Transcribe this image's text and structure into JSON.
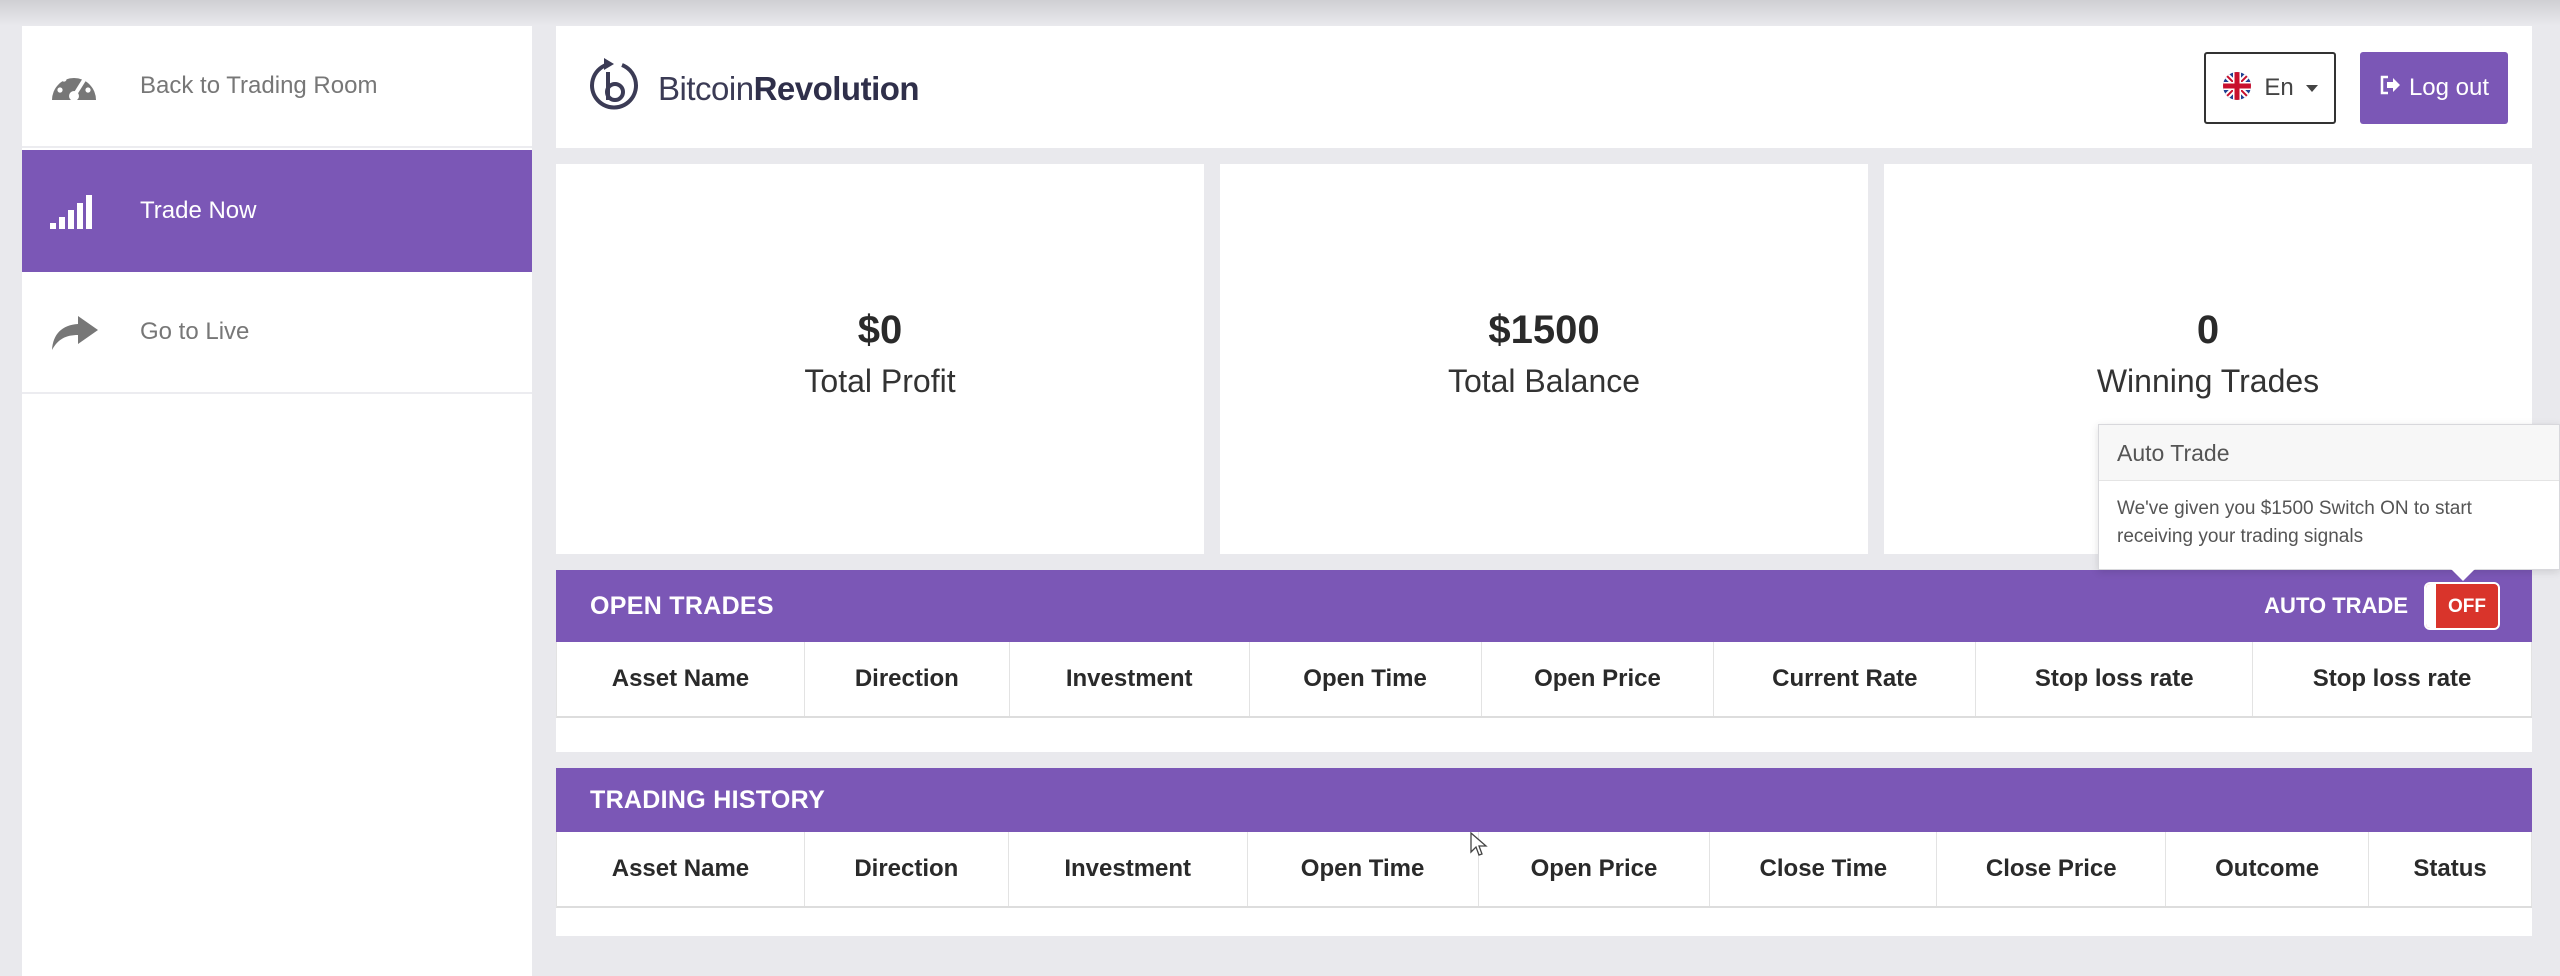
{
  "sidebar": {
    "items": [
      {
        "label": "Back to Trading Room",
        "icon": "speedometer-icon"
      },
      {
        "label": "Trade Now",
        "icon": "signal-bars-icon"
      },
      {
        "label": "Go to Live",
        "icon": "share-arrow-icon"
      }
    ]
  },
  "header": {
    "logo_text_light": "Bitcoin",
    "logo_text_bold": "Revolution",
    "language": "En",
    "logout_label": "Log out"
  },
  "stats": {
    "total_profit": {
      "value": "$0",
      "label": "Total Profit"
    },
    "total_balance": {
      "value": "$1500",
      "label": "Total Balance"
    },
    "winning_trades": {
      "value": "0",
      "label": "Winning Trades"
    }
  },
  "tooltip": {
    "title": "Auto Trade",
    "body": "We've given you $1500 Switch ON to start receiving your trading signals"
  },
  "open_trades": {
    "title": "OPEN TRADES",
    "auto_trade_label": "AUTO TRADE",
    "toggle_state": "OFF",
    "columns": [
      "Asset Name",
      "Direction",
      "Investment",
      "Open Time",
      "Open Price",
      "Current Rate",
      "Stop loss rate",
      "Stop loss rate"
    ]
  },
  "trading_history": {
    "title": "TRADING HISTORY",
    "columns": [
      "Asset Name",
      "Direction",
      "Investment",
      "Open Time",
      "Open Price",
      "Close Time",
      "Close Price",
      "Outcome",
      "Status"
    ]
  },
  "colors": {
    "accent": "#7b57b6",
    "off_toggle": "#d9342b"
  }
}
